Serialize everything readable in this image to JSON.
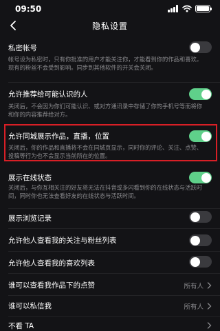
{
  "status": {
    "time": "09:50"
  },
  "nav": {
    "title": "隐私设置"
  },
  "private_account": {
    "title": "私密帐号",
    "desc": "帐号设为私密时，只有你批准的用户才能关注你，才能看到你的作品和喜欢。现有的粉丝不会受到影响。同步到其他软件的开关会关闭。",
    "enabled": false
  },
  "recommend": {
    "title": "允许推荐给可能认识的人",
    "desc": "关闭后，不会因为你们可能认识、或对方通讯录中存储了你的手机号等而将你和你的内容推荐给对方。",
    "enabled": true
  },
  "city_display": {
    "title": "允许同城展示作品，直播，位置",
    "desc": "关闭后，你的作品和直播将不会在同城页显示，同时你的评论、关注、点赞、投稿等行为也不会显示当前所在的位置。",
    "enabled": true
  },
  "online_status": {
    "title": "展示在线状态",
    "desc": "关闭后，与你互相关注的好友将无法在抖音或多闪看到你的在线状态与活跃时间，同时你也无法查看好友的在线状态与活跃时间。",
    "enabled": true
  },
  "browse_history": {
    "title": "展示浏览记录",
    "enabled": false
  },
  "follow_list": {
    "title": "允许他人查看我的关注与粉丝列表",
    "enabled": false
  },
  "like_list": {
    "title": "允许他人查看我的喜欢列表",
    "enabled": false
  },
  "likes_visibility": {
    "title": "谁可以查看我作品下的点赞",
    "value": "所有人"
  },
  "dm_permission": {
    "title": "谁可以私信我",
    "value": "所有人"
  },
  "not_see": {
    "title": "不看 TA"
  },
  "colors": {
    "accent": "#5fd08a",
    "highlight": "#d81f26",
    "background": "#131316"
  }
}
